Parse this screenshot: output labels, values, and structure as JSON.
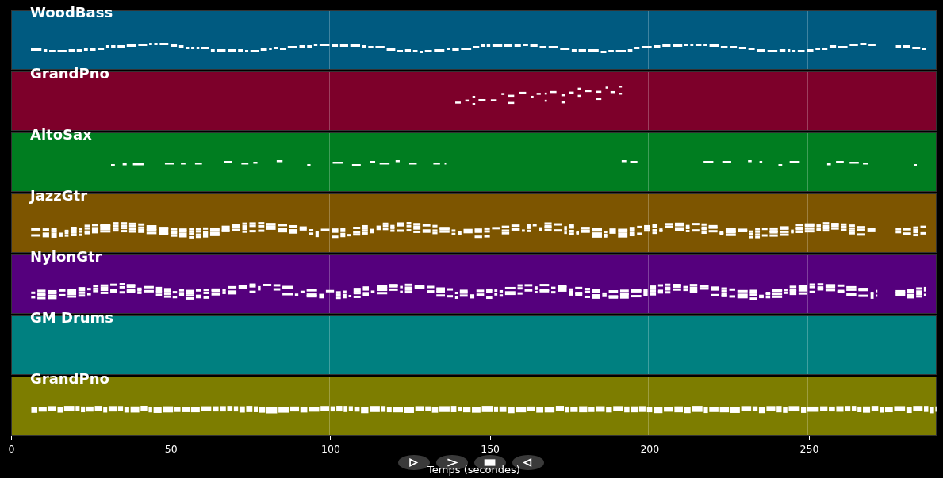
{
  "tracks": [
    {
      "name": "WoodBass",
      "color": "#005a80",
      "kind": "melody"
    },
    {
      "name": "GrandPno",
      "color": "#7d002a",
      "kind": "fragment"
    },
    {
      "name": "AltoSax",
      "color": "#007d20",
      "kind": "phrases"
    },
    {
      "name": "JazzGtr",
      "color": "#7d5500",
      "kind": "chords"
    },
    {
      "name": "NylonGtr",
      "color": "#55007d",
      "kind": "chords"
    },
    {
      "name": "GM Drums",
      "color": "#008080",
      "kind": "empty"
    },
    {
      "name": "GrandPno",
      "color": "#7d7d00",
      "kind": "sustained"
    }
  ],
  "axis": {
    "ticks": [
      "0",
      "50",
      "100",
      "150",
      "200",
      "250"
    ],
    "label": "Temps (secondes)"
  },
  "toolbar": {
    "buttons": [
      {
        "kind": "play"
      },
      {
        "kind": "forward"
      },
      {
        "kind": "stop"
      },
      {
        "kind": "back"
      }
    ]
  }
}
